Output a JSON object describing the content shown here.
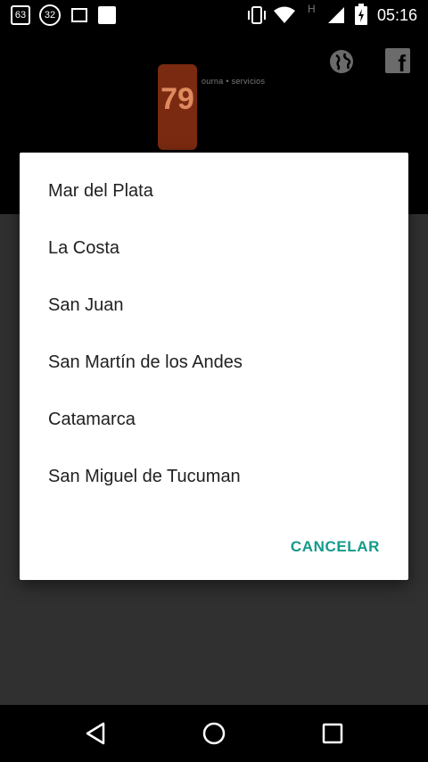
{
  "status_bar": {
    "notif_63": "63",
    "notif_32": "32",
    "time": "05:16",
    "network_label": "H"
  },
  "app": {
    "logo_number": "79",
    "logo_tagline": "ourna • servicios"
  },
  "dialog": {
    "options": [
      "Mar del Plata",
      "La Costa",
      "San Juan",
      "San Martín de los Andes",
      "Catamarca",
      "San Miguel de Tucuman"
    ],
    "cancel_label": "CANCELAR"
  },
  "colors": {
    "accent": "#139a8a",
    "dialog_bg": "#ffffff",
    "logo_bg": "#7a2a10"
  }
}
